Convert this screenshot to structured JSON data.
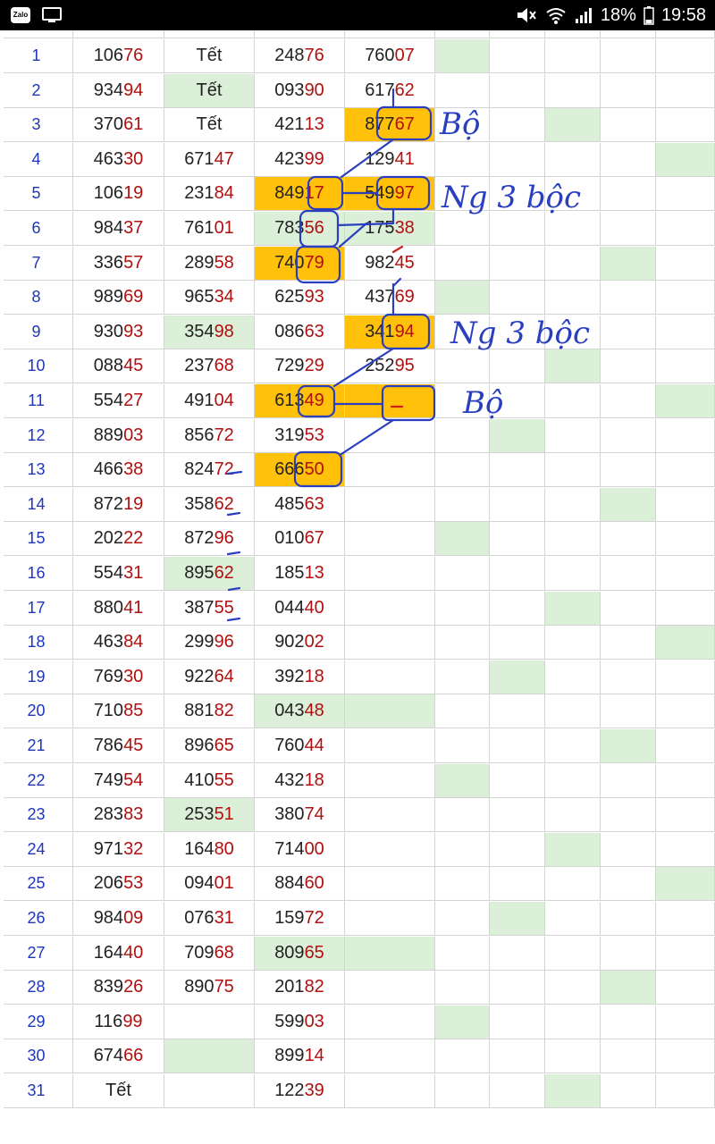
{
  "status_bar": {
    "battery_text": "18%",
    "time": "19:58",
    "icons": [
      "zalo-icon",
      "screen-mirror-icon",
      "mute-icon",
      "wifi-icon",
      "signal-icon",
      "battery-icon"
    ]
  },
  "annotations": [
    "Bộ",
    "Ng 3 bộc",
    "Ng 3 bộc",
    "Bộ"
  ],
  "rows": [
    {
      "i": "1",
      "c": [
        [
          "106",
          "76"
        ],
        "Tết",
        [
          "248",
          "76"
        ],
        [
          "760",
          "07"
        ]
      ],
      "g": [
        0,
        0,
        0,
        0,
        0,
        1,
        0,
        0,
        0,
        0
      ],
      "o": [
        0,
        0,
        0,
        0
      ]
    },
    {
      "i": "2",
      "c": [
        [
          "934",
          "94"
        ],
        "Tết",
        [
          "093",
          "90"
        ],
        [
          "617",
          "62"
        ]
      ],
      "g": [
        0,
        1,
        0,
        0,
        0,
        0,
        0,
        0,
        0,
        0
      ],
      "o": [
        0,
        0,
        0,
        0
      ]
    },
    {
      "i": "3",
      "c": [
        [
          "370",
          "61"
        ],
        "Tết",
        [
          "421",
          "13"
        ],
        [
          "877",
          "67"
        ]
      ],
      "g": [
        0,
        0,
        0,
        0,
        0,
        0,
        0,
        1,
        0,
        0
      ],
      "o": [
        0,
        0,
        0,
        1
      ]
    },
    {
      "i": "4",
      "c": [
        [
          "463",
          "30"
        ],
        [
          "671",
          "47"
        ],
        [
          "423",
          "99"
        ],
        [
          "129",
          "41"
        ]
      ],
      "g": [
        0,
        0,
        0,
        0,
        0,
        0,
        0,
        0,
        0,
        1
      ],
      "o": [
        0,
        0,
        0,
        0
      ]
    },
    {
      "i": "5",
      "c": [
        [
          "106",
          "19"
        ],
        [
          "231",
          "84"
        ],
        [
          "849",
          "17"
        ],
        [
          "549",
          "97"
        ]
      ],
      "g": [
        0,
        0,
        0,
        0,
        0,
        0,
        0,
        0,
        0,
        0
      ],
      "o": [
        0,
        0,
        1,
        1
      ]
    },
    {
      "i": "6",
      "c": [
        [
          "984",
          "37"
        ],
        [
          "761",
          "01"
        ],
        [
          "783",
          "56"
        ],
        [
          "175",
          "38"
        ]
      ],
      "g": [
        0,
        0,
        1,
        1,
        0,
        0,
        0,
        0,
        0,
        0
      ],
      "o": [
        0,
        0,
        0,
        0
      ]
    },
    {
      "i": "7",
      "c": [
        [
          "336",
          "57"
        ],
        [
          "289",
          "58"
        ],
        [
          "740",
          "79"
        ],
        [
          "982",
          "45"
        ]
      ],
      "g": [
        0,
        0,
        0,
        0,
        0,
        0,
        0,
        0,
        1,
        0
      ],
      "o": [
        0,
        0,
        1,
        0
      ]
    },
    {
      "i": "8",
      "c": [
        [
          "989",
          "69"
        ],
        [
          "965",
          "34"
        ],
        [
          "625",
          "93"
        ],
        [
          "437",
          "69"
        ]
      ],
      "g": [
        0,
        0,
        0,
        0,
        0,
        1,
        0,
        0,
        0,
        0
      ],
      "o": [
        0,
        0,
        0,
        0
      ]
    },
    {
      "i": "9",
      "c": [
        [
          "930",
          "93"
        ],
        [
          "354",
          "98"
        ],
        [
          "086",
          "63"
        ],
        [
          "341",
          "94"
        ]
      ],
      "g": [
        0,
        1,
        0,
        0,
        0,
        0,
        0,
        0,
        0,
        0
      ],
      "o": [
        0,
        0,
        0,
        1
      ]
    },
    {
      "i": "10",
      "c": [
        [
          "088",
          "45"
        ],
        [
          "237",
          "68"
        ],
        [
          "729",
          "29"
        ],
        [
          "252",
          "95"
        ]
      ],
      "g": [
        0,
        0,
        0,
        0,
        1,
        0,
        0,
        1,
        0,
        0
      ],
      "o": [
        0,
        0,
        0,
        0
      ]
    },
    {
      "i": "11",
      "c": [
        [
          "554",
          "27"
        ],
        [
          "491",
          "04"
        ],
        [
          "613",
          "49"
        ],
        ""
      ],
      "g": [
        0,
        0,
        0,
        0,
        0,
        0,
        0,
        0,
        0,
        1
      ],
      "o": [
        0,
        0,
        1,
        1
      ]
    },
    {
      "i": "12",
      "c": [
        [
          "889",
          "03"
        ],
        [
          "856",
          "72"
        ],
        [
          "319",
          "53"
        ],
        ""
      ],
      "g": [
        0,
        0,
        0,
        0,
        0,
        0,
        1,
        0,
        0,
        0
      ],
      "o": [
        0,
        0,
        0,
        0
      ]
    },
    {
      "i": "13",
      "c": [
        [
          "466",
          "38"
        ],
        [
          "824",
          "72"
        ],
        [
          "666",
          "50"
        ],
        ""
      ],
      "g": [
        0,
        0,
        1,
        0,
        0,
        0,
        0,
        0,
        0,
        0
      ],
      "o": [
        0,
        0,
        1,
        0
      ]
    },
    {
      "i": "14",
      "c": [
        [
          "872",
          "19"
        ],
        [
          "358",
          "62"
        ],
        [
          "485",
          "63"
        ],
        ""
      ],
      "g": [
        0,
        0,
        0,
        0,
        0,
        0,
        0,
        0,
        1,
        0
      ],
      "o": [
        0,
        0,
        0,
        0
      ]
    },
    {
      "i": "15",
      "c": [
        [
          "202",
          "22"
        ],
        [
          "872",
          "96"
        ],
        [
          "010",
          "67"
        ],
        ""
      ],
      "g": [
        0,
        0,
        0,
        0,
        0,
        1,
        0,
        0,
        0,
        0
      ],
      "o": [
        0,
        0,
        0,
        0
      ]
    },
    {
      "i": "16",
      "c": [
        [
          "554",
          "31"
        ],
        [
          "895",
          "62"
        ],
        [
          "185",
          "13"
        ],
        ""
      ],
      "g": [
        0,
        1,
        0,
        0,
        0,
        0,
        0,
        0,
        0,
        0
      ],
      "o": [
        0,
        0,
        0,
        0
      ]
    },
    {
      "i": "17",
      "c": [
        [
          "880",
          "41"
        ],
        [
          "387",
          "55"
        ],
        [
          "044",
          "40"
        ],
        ""
      ],
      "g": [
        0,
        0,
        0,
        0,
        1,
        0,
        0,
        1,
        0,
        0
      ],
      "o": [
        0,
        0,
        0,
        0
      ]
    },
    {
      "i": "18",
      "c": [
        [
          "463",
          "84"
        ],
        [
          "299",
          "96"
        ],
        [
          "902",
          "02"
        ],
        ""
      ],
      "g": [
        0,
        0,
        0,
        0,
        0,
        0,
        0,
        0,
        0,
        1
      ],
      "o": [
        0,
        0,
        0,
        0
      ]
    },
    {
      "i": "19",
      "c": [
        [
          "769",
          "30"
        ],
        [
          "922",
          "64"
        ],
        [
          "392",
          "18"
        ],
        ""
      ],
      "g": [
        0,
        0,
        0,
        0,
        0,
        0,
        1,
        0,
        0,
        0
      ],
      "o": [
        0,
        0,
        0,
        0
      ]
    },
    {
      "i": "20",
      "c": [
        [
          "710",
          "85"
        ],
        [
          "881",
          "82"
        ],
        [
          "043",
          "48"
        ],
        ""
      ],
      "g": [
        0,
        0,
        1,
        1,
        0,
        0,
        0,
        0,
        0,
        0
      ],
      "o": [
        0,
        0,
        0,
        0
      ]
    },
    {
      "i": "21",
      "c": [
        [
          "786",
          "45"
        ],
        [
          "896",
          "65"
        ],
        [
          "760",
          "44"
        ],
        ""
      ],
      "g": [
        0,
        0,
        0,
        0,
        0,
        0,
        0,
        0,
        1,
        0
      ],
      "o": [
        0,
        0,
        0,
        0
      ]
    },
    {
      "i": "22",
      "c": [
        [
          "749",
          "54"
        ],
        [
          "410",
          "55"
        ],
        [
          "432",
          "18"
        ],
        ""
      ],
      "g": [
        0,
        0,
        0,
        0,
        0,
        1,
        0,
        0,
        0,
        0
      ],
      "o": [
        0,
        0,
        0,
        0
      ]
    },
    {
      "i": "23",
      "c": [
        [
          "283",
          "83"
        ],
        [
          "253",
          "51"
        ],
        [
          "380",
          "74"
        ],
        ""
      ],
      "g": [
        0,
        1,
        0,
        0,
        0,
        0,
        0,
        0,
        0,
        0
      ],
      "o": [
        0,
        0,
        0,
        0
      ]
    },
    {
      "i": "24",
      "c": [
        [
          "971",
          "32"
        ],
        [
          "164",
          "80"
        ],
        [
          "714",
          "00"
        ],
        ""
      ],
      "g": [
        0,
        0,
        0,
        0,
        1,
        0,
        0,
        1,
        0,
        0
      ],
      "o": [
        0,
        0,
        0,
        0
      ]
    },
    {
      "i": "25",
      "c": [
        [
          "206",
          "53"
        ],
        [
          "094",
          "01"
        ],
        [
          "884",
          "60"
        ],
        ""
      ],
      "g": [
        0,
        0,
        0,
        0,
        0,
        0,
        0,
        0,
        0,
        1
      ],
      "o": [
        0,
        0,
        0,
        0
      ]
    },
    {
      "i": "26",
      "c": [
        [
          "984",
          "09"
        ],
        [
          "076",
          "31"
        ],
        [
          "159",
          "72"
        ],
        ""
      ],
      "g": [
        0,
        0,
        0,
        0,
        0,
        0,
        1,
        0,
        0,
        0
      ],
      "o": [
        0,
        0,
        0,
        0
      ]
    },
    {
      "i": "27",
      "c": [
        [
          "164",
          "40"
        ],
        [
          "709",
          "68"
        ],
        [
          "809",
          "65"
        ],
        ""
      ],
      "g": [
        0,
        0,
        1,
        1,
        0,
        0,
        0,
        0,
        0,
        0
      ],
      "o": [
        0,
        0,
        0,
        0
      ]
    },
    {
      "i": "28",
      "c": [
        [
          "839",
          "26"
        ],
        [
          "890",
          "75"
        ],
        [
          "201",
          "82"
        ],
        ""
      ],
      "g": [
        0,
        0,
        0,
        0,
        0,
        0,
        0,
        0,
        1,
        0
      ],
      "o": [
        0,
        0,
        0,
        0
      ]
    },
    {
      "i": "29",
      "c": [
        [
          "116",
          "99"
        ],
        "",
        [
          "599",
          "03"
        ],
        ""
      ],
      "g": [
        0,
        0,
        0,
        0,
        0,
        1,
        0,
        0,
        0,
        0
      ],
      "o": [
        0,
        0,
        0,
        0
      ]
    },
    {
      "i": "30",
      "c": [
        [
          "674",
          "66"
        ],
        "",
        [
          "899",
          "14"
        ],
        ""
      ],
      "g": [
        0,
        1,
        0,
        0,
        0,
        0,
        0,
        0,
        0,
        0
      ],
      "o": [
        0,
        0,
        0,
        0
      ]
    },
    {
      "i": "31",
      "c": [
        "Tết",
        "",
        [
          "122",
          "39"
        ],
        ""
      ],
      "g": [
        0,
        0,
        0,
        0,
        0,
        0,
        0,
        1,
        0,
        0
      ],
      "o": [
        0,
        0,
        0,
        0
      ]
    }
  ]
}
